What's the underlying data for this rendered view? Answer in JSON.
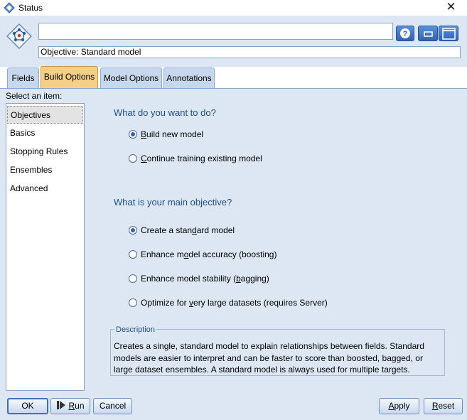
{
  "window": {
    "title": "Status",
    "close_glyph": "✕",
    "icon": "diamond-app-icon"
  },
  "header": {
    "node_icon": "ensemble-node-icon",
    "name_value": "",
    "objective_text": "Objective: Standard model",
    "help_glyph": "?",
    "buttons": [
      "help-icon",
      "minimize-icon",
      "maximize-icon"
    ]
  },
  "tabs": [
    {
      "label": "Fields",
      "selected": false
    },
    {
      "label": "Build Options",
      "selected": true
    },
    {
      "label": "Model Options",
      "selected": false
    },
    {
      "label": "Annotations",
      "selected": false
    }
  ],
  "sidebar": {
    "label": "Select an item:",
    "items": [
      {
        "label": "Objectives",
        "selected": true
      },
      {
        "label": "Basics",
        "selected": false
      },
      {
        "label": "Stopping Rules",
        "selected": false
      },
      {
        "label": "Ensembles",
        "selected": false
      },
      {
        "label": "Advanced",
        "selected": false
      }
    ]
  },
  "main": {
    "q1": {
      "heading": "What do you want to do?",
      "options": [
        {
          "pre": "",
          "u": "B",
          "post": "uild new model",
          "checked": true
        },
        {
          "pre": "",
          "u": "C",
          "post": "ontinue training existing model",
          "checked": false
        }
      ]
    },
    "q2": {
      "heading": "What is your main objective?",
      "options": [
        {
          "pre": "Create a stan",
          "u": "d",
          "post": "ard model",
          "checked": true
        },
        {
          "pre": "Enhance m",
          "u": "o",
          "post": "del accuracy (boosting)",
          "checked": false
        },
        {
          "pre": "Enhance model stability (",
          "u": "b",
          "post": "agging)",
          "checked": false
        },
        {
          "pre": "Optimize for ",
          "u": "v",
          "post": "ery large datasets (requires Server)",
          "checked": false
        }
      ]
    },
    "description": {
      "legend": "Description",
      "text": "Creates a single, standard model to explain relationships between fields.  Standard models are easier to interpret and can be faster to score than boosted, bagged, or large dataset ensembles. A standard model is always used for multiple targets."
    }
  },
  "footer": {
    "ok": "OK",
    "run_pre": "",
    "run_u": "R",
    "run_post": "un",
    "run_icon": "run-arrow-icon",
    "cancel": "Cancel",
    "apply_pre": "",
    "apply_u": "A",
    "apply_post": "pply",
    "reset_pre": "",
    "reset_u": "R",
    "reset_post": "eset"
  },
  "colors": {
    "panel_bg": "#dde7f3",
    "heading": "#1f4e87",
    "active_tab": "#f5cf86",
    "tab_bg": "#c7d7ec"
  }
}
